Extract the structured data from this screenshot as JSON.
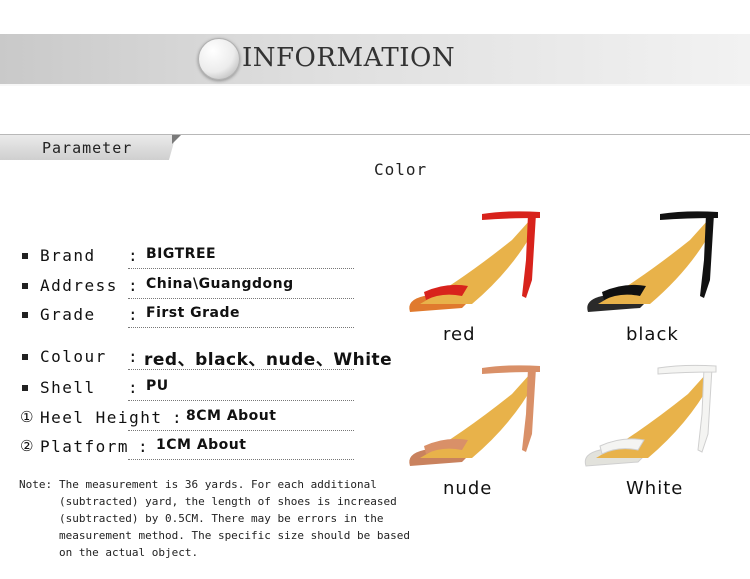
{
  "banner": {
    "title": "INFORMATION"
  },
  "parameter": {
    "tab_label": "Parameter"
  },
  "color_section": {
    "title": "Color"
  },
  "specs": [
    {
      "key": "Brand",
      "value": "BIGTREE",
      "marker": "square"
    },
    {
      "key": "Address",
      "value": "China\\Guangdong",
      "marker": "square"
    },
    {
      "key": "Grade",
      "value": "First Grade",
      "marker": "square"
    },
    {
      "key": "Colour",
      "value": "red、black、nude、White",
      "marker": "square"
    },
    {
      "key": "Shell",
      "value": "PU",
      "marker": "square"
    },
    {
      "key": "Heel Height",
      "value": "8CM About",
      "marker": "①"
    },
    {
      "key": "Platform",
      "value": "1CM About",
      "marker": "②"
    }
  ],
  "note": {
    "prefix": "Note:",
    "text": "The measurement is 36 yards. For each additional (subtracted) yard, the length of shoes is increased (subtracted) by 0.5CM. There may be errors in the measurement method. The specific size should be based on the actual object."
  },
  "shoes": [
    {
      "label": "red",
      "color": "#d8231c",
      "sole": "#e07a2e"
    },
    {
      "label": "black",
      "color": "#111111",
      "sole": "#2a2a2a"
    },
    {
      "label": "nude",
      "color": "#d99068",
      "sole": "#c9825e"
    },
    {
      "label": "White",
      "color": "#f4f4f2",
      "sole": "#e2e2dc"
    }
  ],
  "colors": {
    "banner": "#d9d9d9",
    "insole": "#e8b24a"
  }
}
